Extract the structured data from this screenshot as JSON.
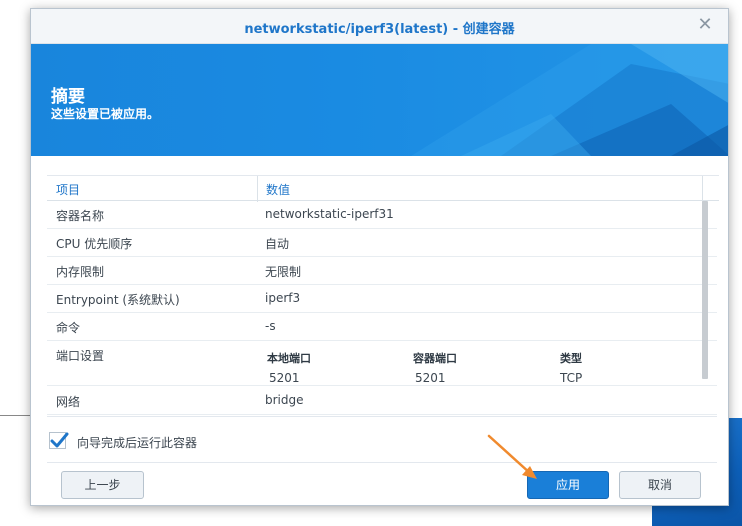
{
  "dialog": {
    "title": "networkstatic/iperf3(latest) - 创建容器",
    "close_glyph": "✕"
  },
  "banner": {
    "title": "摘要",
    "subtitle": "这些设置已被应用。"
  },
  "table": {
    "headers": [
      "项目",
      "数值"
    ],
    "rows": [
      {
        "key": "容器名称",
        "value": "networkstatic-iperf31"
      },
      {
        "key": "CPU 优先顺序",
        "value": "自动"
      },
      {
        "key": "内存限制",
        "value": "无限制"
      },
      {
        "key": "Entrypoint (系统默认)",
        "value": "iperf3"
      },
      {
        "key": "命令",
        "value": "-s"
      }
    ],
    "ports": {
      "key": "端口设置",
      "headers": [
        "本地端口",
        "容器端口",
        "类型"
      ],
      "values": [
        "5201",
        "5201",
        "TCP"
      ]
    },
    "network": {
      "key": "网络",
      "value": "bridge"
    }
  },
  "checkbox": {
    "label": "向导完成后运行此容器",
    "checked": true
  },
  "buttons": {
    "back": "上一步",
    "apply": "应用",
    "cancel": "取消"
  },
  "colors": {
    "accent": "#1f76c9",
    "banner": "#1a8be2",
    "annotation_arrow": "#f08a2e"
  }
}
